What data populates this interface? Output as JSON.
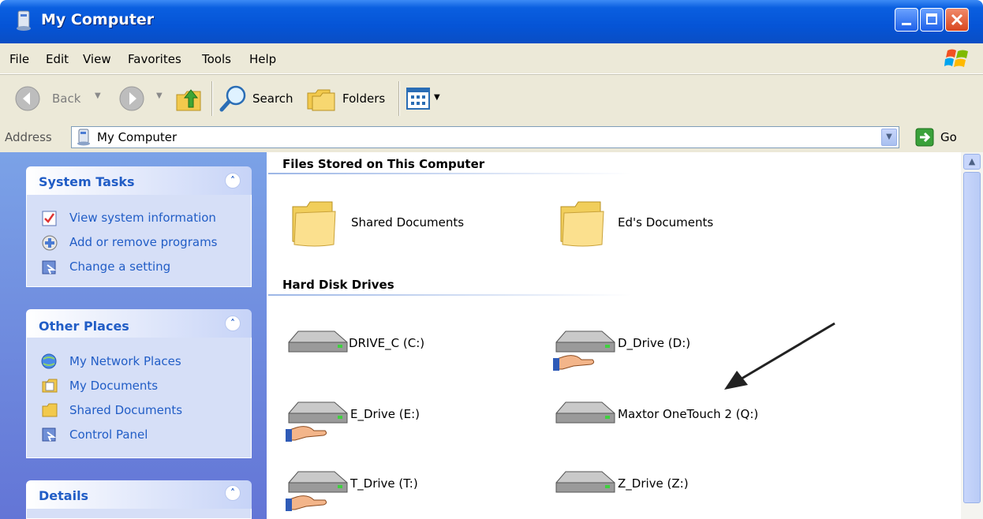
{
  "window": {
    "title": "My Computer"
  },
  "menu": [
    "File",
    "Edit",
    "View",
    "Favorites",
    "Tools",
    "Help"
  ],
  "toolbar": {
    "back": "Back",
    "search": "Search",
    "folders": "Folders"
  },
  "address": {
    "label": "Address",
    "value": "My Computer",
    "go": "Go"
  },
  "left_pane": {
    "system_tasks": {
      "title": "System Tasks",
      "items": [
        "View system information",
        "Add or remove programs",
        "Change a setting"
      ]
    },
    "other_places": {
      "title": "Other Places",
      "items": [
        "My Network Places",
        "My Documents",
        "Shared Documents",
        "Control Panel"
      ]
    },
    "details": {
      "title": "Details"
    }
  },
  "content": {
    "files_group": {
      "title": "Files Stored on This Computer",
      "items": [
        "Shared Documents",
        "Ed's Documents"
      ]
    },
    "drives_group": {
      "title": "Hard Disk Drives",
      "items": [
        "DRIVE_C (C:)",
        "D_Drive (D:)",
        "E_Drive (E:)",
        "Maxtor OneTouch 2 (Q:)",
        "T_Drive (T:)",
        "Z_Drive (Z:)"
      ]
    }
  },
  "colors": {
    "title_bar": "#0554d6",
    "task_pane_link": "#215dc6",
    "chrome": "#ece9d8"
  }
}
